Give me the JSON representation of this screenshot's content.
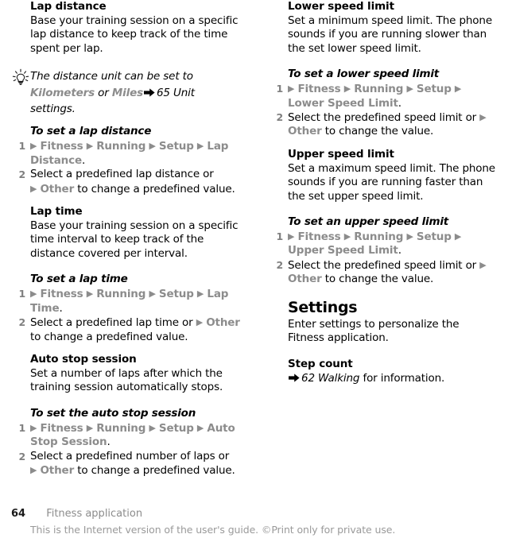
{
  "document": {
    "page_number": "64",
    "chapter": "Fitness application",
    "legal_notice": "This is the Internet version of the user's guide. ©Print only for private use."
  },
  "icons": {
    "tip": "lightbulb-icon",
    "arrow": "solid-right-arrow-icon",
    "bullet": "menu-triangle-icon"
  },
  "colors": {
    "menu_text": "#8c8c8c",
    "body_text": "#000000",
    "footer_text": "#9a9a9a"
  },
  "left_column": {
    "lap_distance": {
      "heading": "Lap distance",
      "body": "Base your training session on a specific lap distance to keep track of the time spent per lap."
    },
    "tip": {
      "text_part1": "The distance unit can be set to ",
      "menu1": "Kilometers",
      "text_part2": " or ",
      "menu2": "Miles",
      "ref_number": "65",
      "ref_title": "Unit settings",
      "ref_suffix": "."
    },
    "task_lap_distance": {
      "heading": "To set a lap distance",
      "steps": [
        {
          "num": "1",
          "path": [
            "Fitness",
            "Running",
            "Setup",
            "Lap Distance"
          ],
          "trailing": "."
        },
        {
          "num": "2",
          "prefix": "Select a predefined lap distance or ",
          "menu": "Other",
          "suffix": " to change a predefined value."
        }
      ]
    },
    "lap_time": {
      "heading": "Lap time",
      "body": "Base your training session on a specific time interval to keep track of the distance covered per interval."
    },
    "task_lap_time": {
      "heading": "To set a lap time",
      "steps": [
        {
          "num": "1",
          "path": [
            "Fitness",
            "Running",
            "Setup",
            "Lap Time"
          ],
          "trailing": "."
        },
        {
          "num": "2",
          "prefix": "Select a predefined lap time or ",
          "menu": "Other",
          "suffix": " to change a predefined value."
        }
      ]
    },
    "auto_stop": {
      "heading": "Auto stop session",
      "body": "Set a number of laps after which the training session automatically stops."
    },
    "task_auto_stop": {
      "heading": "To set the auto stop session",
      "steps": [
        {
          "num": "1",
          "path": [
            "Fitness",
            "Running",
            "Setup",
            "Auto Stop Session"
          ],
          "trailing": "."
        },
        {
          "num": "2",
          "prefix": "Select a predefined number of laps or ",
          "menu": "Other",
          "suffix": " to change a predefined value."
        }
      ]
    }
  },
  "right_column": {
    "lower_speed": {
      "heading": "Lower speed limit",
      "body": "Set a minimum speed limit. The phone sounds if you are running slower than the set lower speed limit."
    },
    "task_lower_speed": {
      "heading": "To set a lower speed limit",
      "steps": [
        {
          "num": "1",
          "path": [
            "Fitness",
            "Running",
            "Setup",
            "Lower Speed Limit"
          ],
          "trailing": "."
        },
        {
          "num": "2",
          "prefix": "Select the predefined speed limit or ",
          "menu": "Other",
          "suffix": " to change the value."
        }
      ]
    },
    "upper_speed": {
      "heading": "Upper speed limit",
      "body": "Set a maximum speed limit. The phone sounds if you are running faster than the set upper speed limit."
    },
    "task_upper_speed": {
      "heading": "To set an upper speed limit",
      "steps": [
        {
          "num": "1",
          "path": [
            "Fitness",
            "Running",
            "Setup",
            "Upper Speed Limit"
          ],
          "trailing": "."
        },
        {
          "num": "2",
          "prefix": "Select the predefined speed limit or ",
          "menu": "Other",
          "suffix": " to change the value."
        }
      ]
    },
    "settings": {
      "heading": "Settings",
      "body": "Enter settings to personalize the Fitness application."
    },
    "step_count": {
      "heading": "Step count",
      "ref_number": "62",
      "ref_title": "Walking",
      "ref_suffix": " for information."
    }
  }
}
